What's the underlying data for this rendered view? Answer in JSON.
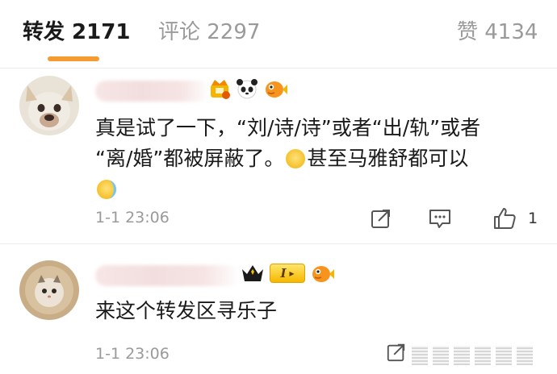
{
  "tabs": {
    "forward": "转发 2171",
    "comment": "评论 2297",
    "like": "赞 4134"
  },
  "comments": [
    {
      "text_line1": "真是试了一下，“刘/诗/诗”或者“出/轨”或者",
      "text_line2_a": "“离/婚”都被屏蔽了。",
      "text_line2_b": "甚至马雅舒都可以",
      "time": "1-1 23:06",
      "like_count": "1",
      "badge_icons": [
        "crown-badge-icon",
        "panda-icon",
        "fish-icon"
      ],
      "emoji_icons": [
        "blushing-emoji-icon",
        "laughing-crying-emoji-icon"
      ]
    },
    {
      "text": "来这个转发区寻乐子",
      "time": "1-1 23:06",
      "level_badge": "I",
      "badge_icons": [
        "vip-crown-icon",
        "level-badge",
        "fish-icon"
      ]
    }
  ],
  "colors": {
    "accent": "#f59b32",
    "muted": "#9a9a9a",
    "text": "#1a1a1a"
  }
}
